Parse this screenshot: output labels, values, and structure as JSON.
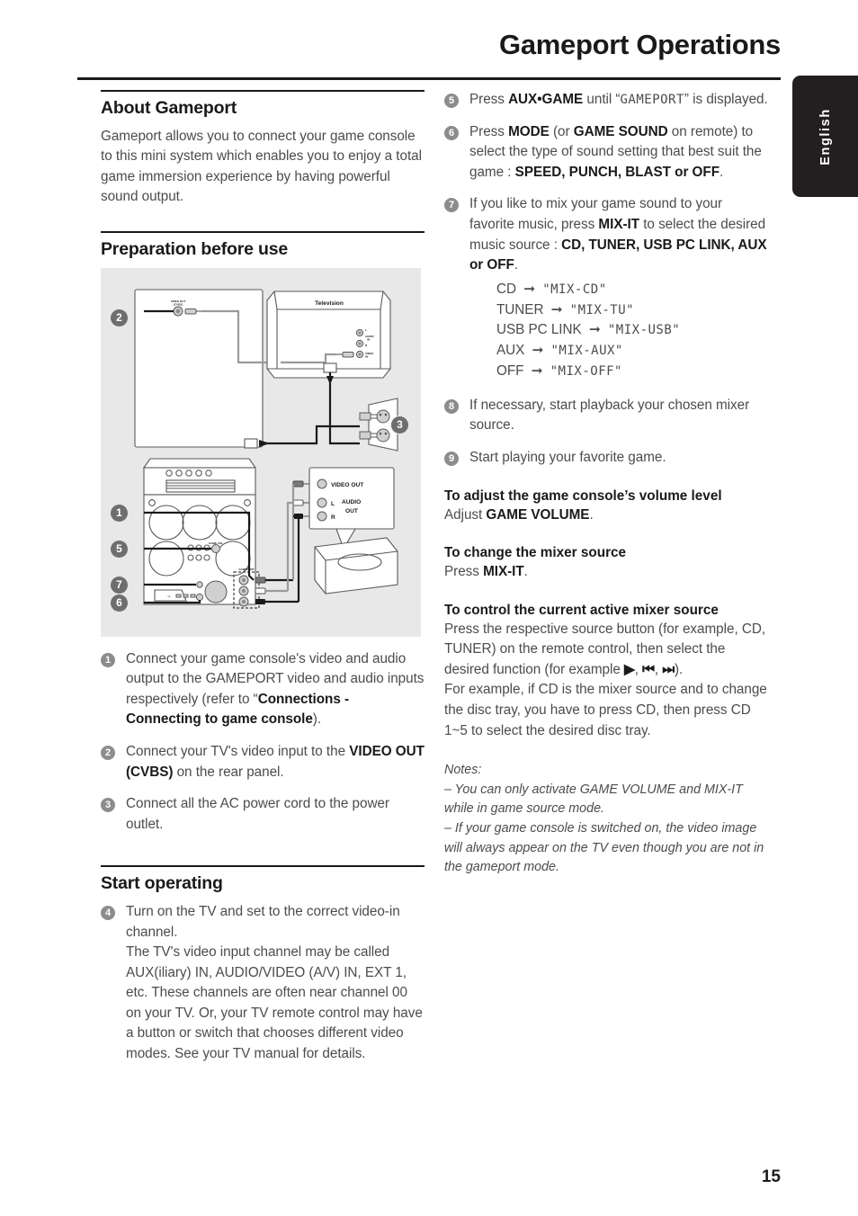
{
  "header": {
    "title": "Gameport Operations",
    "language_tab": "English"
  },
  "page_number": "15",
  "left_column": {
    "about": {
      "heading": "About Gameport",
      "paragraph": "Gameport allows you to connect your game console to this mini system which enables you to enjoy a total game immersion experience by having powerful sound output."
    },
    "preparation": {
      "heading": "Preparation before use"
    },
    "diagram": {
      "tv_label": "Television",
      "rear_video_out_label": "VIDEO OUT (CVBS)",
      "tv_jacks": {
        "l": "L",
        "audio_in": "AUDIO IN",
        "r": "R",
        "video_in": "VIDEO IN"
      },
      "console_callout": {
        "video_out": "VIDEO OUT",
        "l": "L",
        "r": "R",
        "audio_out": "AUDIO OUT"
      },
      "callouts": [
        "1",
        "2",
        "3",
        "5",
        "6",
        "7"
      ]
    },
    "steps": [
      {
        "num": "1",
        "html": "Connect your game console's video and audio output to the GAMEPORT video and audio inputs respectively (refer to “<b>Connections - Connecting to game console</b>)."
      },
      {
        "num": "2",
        "html": "Connect your TV's video input to the <b>VIDEO OUT (CVBS)</b> on the rear panel."
      },
      {
        "num": "3",
        "html": "Connect all the AC power cord to the power outlet."
      }
    ],
    "start_operating": {
      "heading": "Start operating",
      "steps": [
        {
          "num": "4",
          "html": "Turn on the TV and set to the correct video-in channel.<br>The TV's video input channel may be called AUX(iliary) IN, AUDIO/VIDEO (A/V) IN, EXT 1, etc. These channels are often near channel 00 on your TV.  Or, your TV remote control may have a button or switch that chooses different video modes.  See your TV manual for details."
        }
      ]
    }
  },
  "right_column": {
    "steps": [
      {
        "num": "5",
        "html": "Press <b>AUX•GAME</b> until “<span class=\"lcd\">GAMEPORT</span>” is displayed."
      },
      {
        "num": "6",
        "html": "Press <b>MODE</b> (or <b>GAME SOUND</b> on remote) to select the type of sound setting that best suit the game : <b>SPEED, PUNCH, BLAST or OFF</b>."
      },
      {
        "num": "7",
        "html": "If you like to mix your game sound to your favorite music, press <b>MIX-IT</b> to select the desired music source : <b>CD, TUNER, USB PC LINK, AUX or OFF</b>."
      },
      {
        "num": "8",
        "html": "If necessary, start playback your chosen mixer source."
      },
      {
        "num": "9",
        "html": "Start playing your favorite game."
      }
    ],
    "mix_mappings": [
      {
        "source": "CD",
        "display": "\"MIX-CD\""
      },
      {
        "source": "TUNER",
        "display": "\"MIX-TU\""
      },
      {
        "source": "USB PC LINK",
        "display": "\"MIX-USB\""
      },
      {
        "source": "AUX",
        "display": "\"MIX-AUX\""
      },
      {
        "source": "OFF",
        "display": "\"MIX-OFF\""
      }
    ],
    "sub_sections": [
      {
        "heading": "To adjust the game console’s volume level",
        "body_html": "Adjust <b>GAME VOLUME</b>."
      },
      {
        "heading": "To change the mixer source",
        "body_html": "Press <b>MIX-IT</b>."
      },
      {
        "heading": "To control the current active mixer source",
        "body_html": "Press the respective source button (for example, CD, TUNER) on the remote control, then select the desired function (for example <b>▶</b>, <b>⏮</b>, <b>⏭</b>).<br>For example, if CD is the mixer source and to change the disc tray, you have to press CD, then press CD 1~5 to select the desired disc tray."
      }
    ],
    "notes": {
      "label": "Notes:",
      "items": [
        "–  You can only activate GAME VOLUME and MIX-IT while in game source mode.",
        "–  If your game console is switched on, the video image will always appear on the TV even though you are not in the gameport mode."
      ]
    }
  }
}
